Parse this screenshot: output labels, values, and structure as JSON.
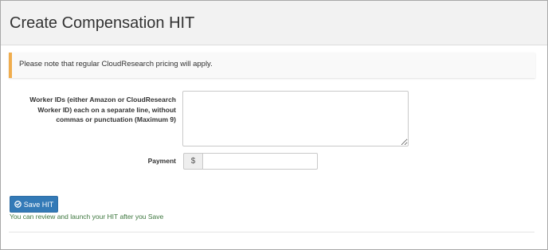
{
  "header": {
    "title": "Create Compensation HIT"
  },
  "alert": {
    "text": "Please note that regular CloudResearch pricing will apply.",
    "accent_color": "#f0ad4e"
  },
  "form": {
    "worker_ids": {
      "label": "Worker IDs (either Amazon or CloudResearch Worker ID) each on a separate line, without commas or punctuation (Maximum 9)",
      "value": ""
    },
    "payment": {
      "label": "Payment",
      "currency_symbol": "$",
      "value": ""
    }
  },
  "actions": {
    "save_label": "Save HIT",
    "save_icon": "check-circle-icon",
    "button_color": "#337ab7",
    "hint": "You can review and launch your HIT after you Save",
    "hint_color": "#3c763d"
  }
}
